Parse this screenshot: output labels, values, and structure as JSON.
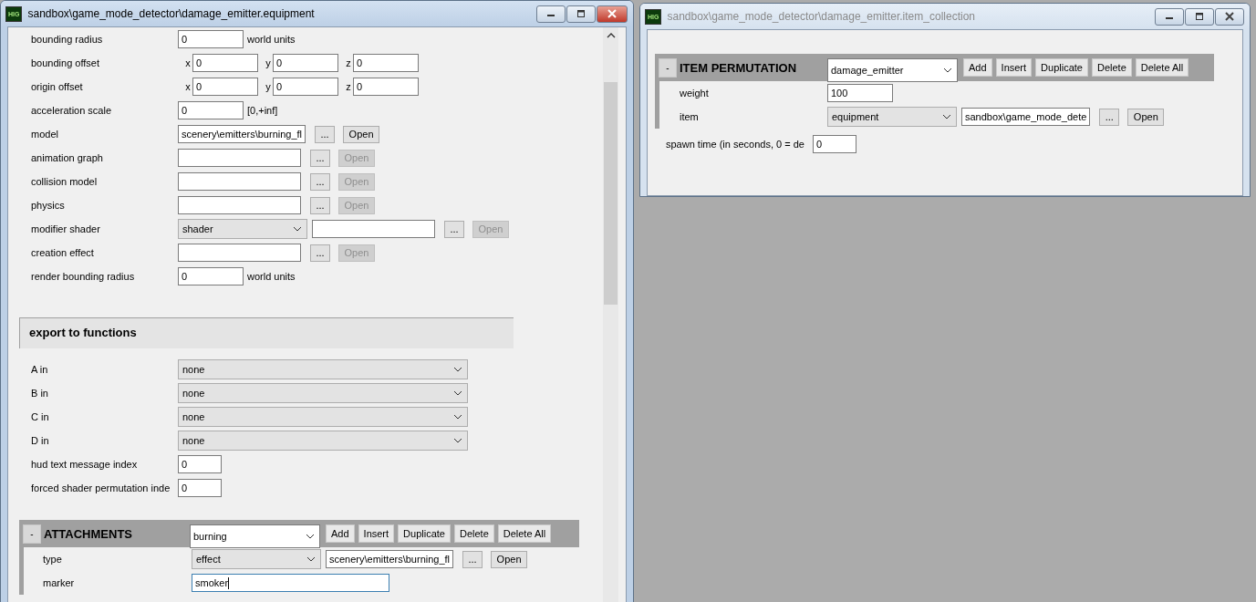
{
  "windows": [
    {
      "title": "sandbox\\game_mode_detector\\damage_emitter.equipment",
      "app_badge": "HIG",
      "active": true,
      "scrollbar": true,
      "rows": [
        {
          "kind": "number",
          "label": "bounding radius",
          "value": "0",
          "suffix": "world units"
        },
        {
          "kind": "vector",
          "label": "bounding offset",
          "components": [
            {
              "axis": "x",
              "value": "0"
            },
            {
              "axis": "y",
              "value": "0"
            },
            {
              "axis": "z",
              "value": "0"
            }
          ]
        },
        {
          "kind": "vector",
          "label": "origin offset",
          "components": [
            {
              "axis": "x",
              "value": "0"
            },
            {
              "axis": "y",
              "value": "0"
            },
            {
              "axis": "z",
              "value": "0"
            }
          ]
        },
        {
          "kind": "number",
          "label": "acceleration scale",
          "value": "0",
          "suffix": "[0,+inf]"
        },
        {
          "kind": "tag",
          "label": "model",
          "value": "scenery\\emitters\\burning_fl",
          "browse": "...",
          "open": "Open",
          "disabled": false
        },
        {
          "kind": "tag",
          "label": "animation graph",
          "browse": "...",
          "open": "Open",
          "disabled": true
        },
        {
          "kind": "tag",
          "label": "collision model",
          "browse": "...",
          "open": "Open",
          "disabled": true
        },
        {
          "kind": "tag",
          "label": "physics",
          "browse": "...",
          "open": "Open",
          "disabled": true
        },
        {
          "kind": "typed_tag",
          "label": "modifier shader",
          "type": "shader",
          "browse": "...",
          "open": "Open",
          "disabled": true
        },
        {
          "kind": "tag",
          "label": "creation effect",
          "browse": "...",
          "open": "Open",
          "disabled": true
        },
        {
          "kind": "number",
          "label": "render bounding radius",
          "value": "0",
          "suffix": "world units"
        },
        {
          "kind": "heading",
          "title": "export to functions"
        },
        {
          "kind": "select",
          "label": "A in",
          "value": "none"
        },
        {
          "kind": "select",
          "label": "B in",
          "value": "none"
        },
        {
          "kind": "select",
          "label": "C in",
          "value": "none"
        },
        {
          "kind": "select",
          "label": "D in",
          "value": "none"
        },
        {
          "kind": "index",
          "label": "hud text message index",
          "value": "0"
        },
        {
          "kind": "index",
          "label": "forced shader permutation inde",
          "value": "0"
        },
        {
          "kind": "block",
          "title": "ATTACHMENTS",
          "collapse": "-",
          "element": "burning",
          "actions": [
            "Add",
            "Insert",
            "Duplicate",
            "Delete",
            "Delete All"
          ],
          "fields": [
            {
              "kind": "typed_tag",
              "label": "type",
              "type": "effect",
              "value": "scenery\\emitters\\burning_fl",
              "browse": "...",
              "open": "Open",
              "disabled": false
            },
            {
              "kind": "text",
              "label": "marker",
              "value": "smoker",
              "focused": true
            }
          ]
        }
      ]
    },
    {
      "title": "sandbox\\game_mode_detector\\damage_emitter.item_collection",
      "app_badge": "HIG",
      "active": false,
      "scrollbar": false,
      "rows": [
        {
          "kind": "block",
          "title": "ITEM PERMUTATION",
          "collapse": "-",
          "element": "damage_emitter",
          "actions": [
            "Add",
            "Insert",
            "Duplicate",
            "Delete",
            "Delete All"
          ],
          "fields": [
            {
              "kind": "number",
              "label": "weight",
              "value": "100"
            },
            {
              "kind": "typed_tag",
              "label": "item",
              "type": "equipment",
              "value": "sandbox\\game_mode_dete",
              "browse": "...",
              "open": "Open",
              "disabled": false
            }
          ]
        },
        {
          "kind": "index",
          "label": "spawn time (in seconds, 0 = de",
          "value": "0"
        }
      ]
    }
  ]
}
